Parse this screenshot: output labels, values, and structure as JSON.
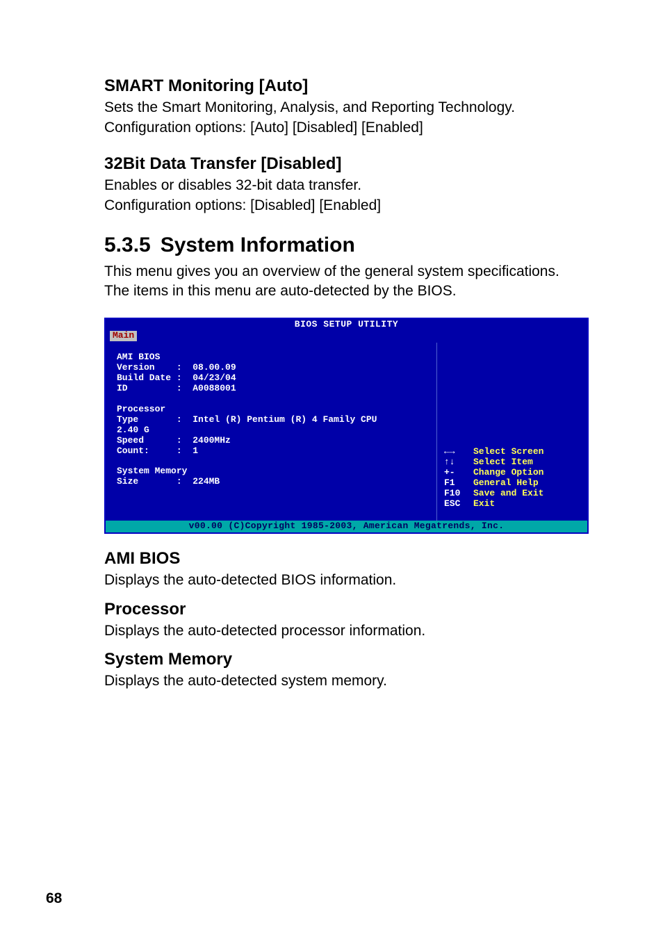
{
  "section1": {
    "heading": "SMART Monitoring [Auto]",
    "line1": "Sets the Smart Monitoring, Analysis, and Reporting Technology.",
    "line2": "Configuration options: [Auto] [Disabled] [Enabled]"
  },
  "section2": {
    "heading": "32Bit Data Transfer [Disabled]",
    "line1": "Enables or disables 32-bit data transfer.",
    "line2": "Configuration options: [Disabled] [Enabled]"
  },
  "sysinfo": {
    "number": "5.3.5",
    "title": "System Information",
    "line1": "This menu gives you an overview of the general system specifications.",
    "line2": "The items in this menu are auto-detected by the BIOS."
  },
  "bios": {
    "title": "BIOS SETUP UTILITY",
    "tab": "Main",
    "left": {
      "ami_header": "AMI BIOS",
      "version": "Version    :  08.00.09",
      "builddate": "Build Date :  04/23/04",
      "id": "ID         :  A0088001",
      "proc_header": "Processor",
      "type": "Type       :  Intel (R) Pentium (R) 4 Family CPU",
      "ghz": "2.40 G",
      "speed": "Speed      :  2400MHz",
      "count": "Count:     :  1",
      "mem_header": "System Memory",
      "size": "Size       :  224MB"
    },
    "help": {
      "r1": {
        "key": "←→",
        "label": "Select Screen"
      },
      "r2": {
        "key": "↑↓",
        "label": "Select Item"
      },
      "r3": {
        "key": "+-",
        "label": "Change Option"
      },
      "r4": {
        "key": "F1",
        "label": "General Help"
      },
      "r5": {
        "key": "F10",
        "label": "Save and Exit"
      },
      "r6": {
        "key": "ESC",
        "label": "Exit"
      }
    },
    "footer": "v00.00 (C)Copyright 1985-2003, American Megatrends, Inc."
  },
  "after": {
    "h1": "AMI BIOS",
    "t1": "Displays the auto-detected BIOS information.",
    "h2": "Processor",
    "t2": "Displays the auto-detected processor information.",
    "h3": "System Memory",
    "t3": "Displays the auto-detected system memory."
  },
  "pageNumber": "68"
}
